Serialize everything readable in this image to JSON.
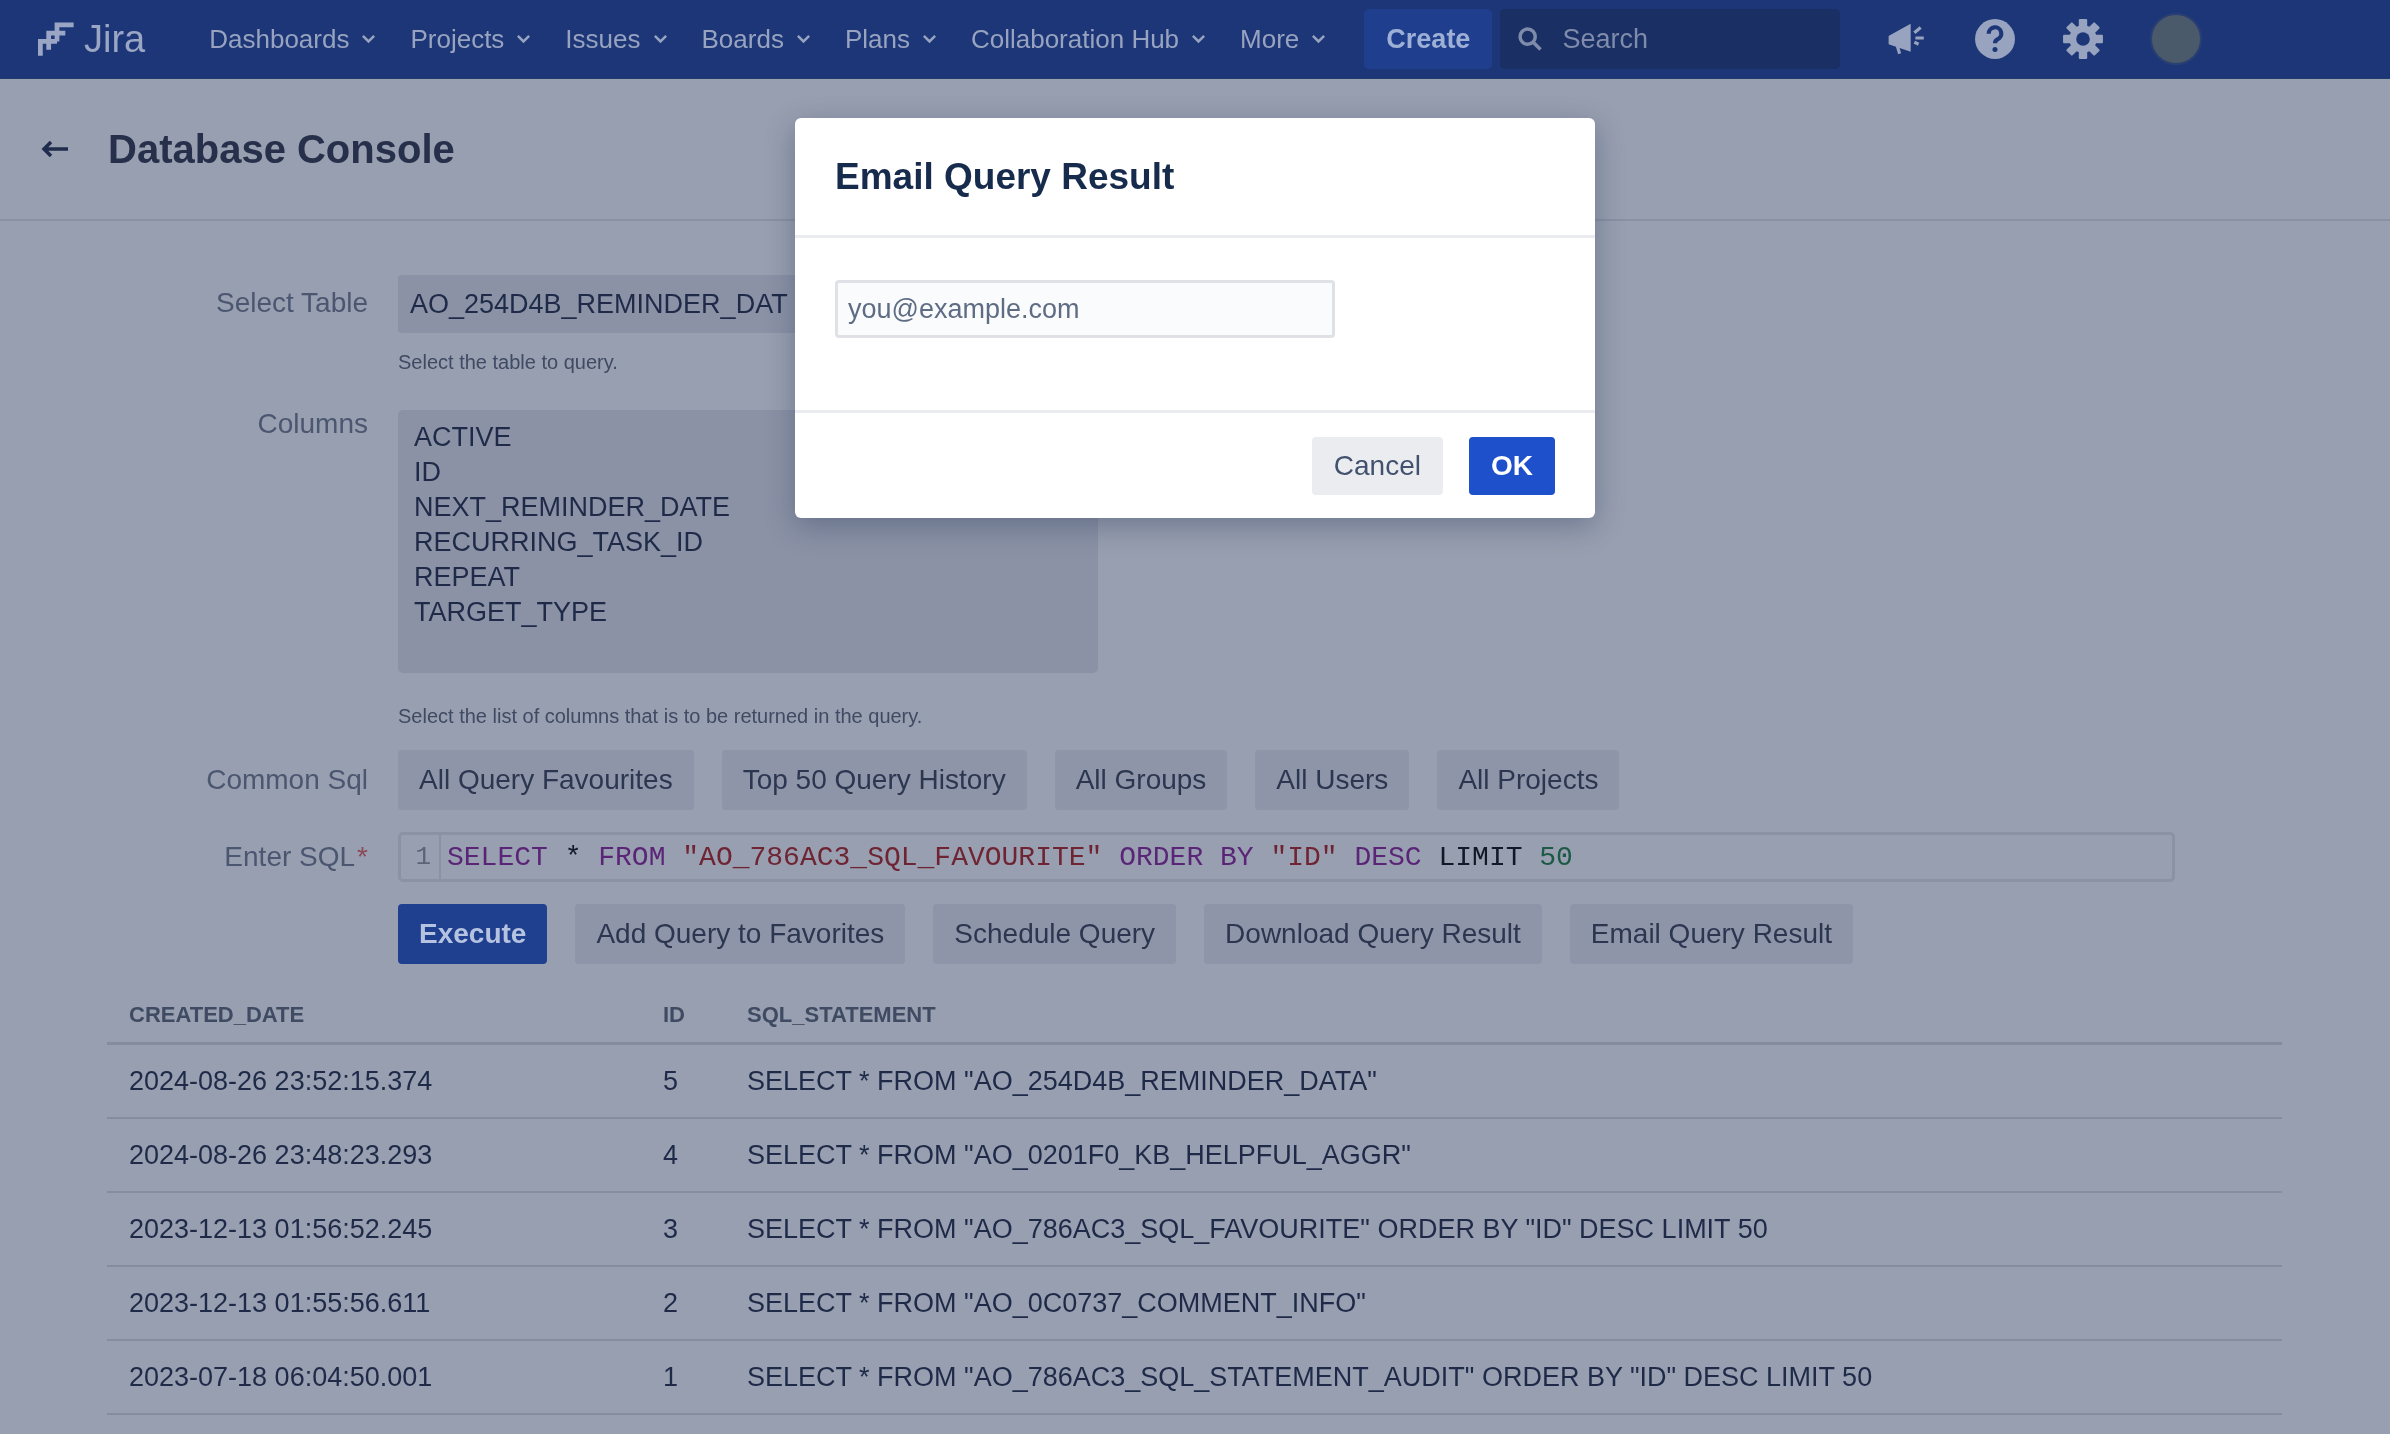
{
  "nav": {
    "logo": "Jira",
    "menus": [
      {
        "label": "Dashboards",
        "dropdown": true
      },
      {
        "label": "Projects",
        "dropdown": true
      },
      {
        "label": "Issues",
        "dropdown": true
      },
      {
        "label": "Boards",
        "dropdown": true
      },
      {
        "label": "Plans",
        "dropdown": true
      },
      {
        "label": "Collaboration Hub",
        "dropdown": true
      },
      {
        "label": "More",
        "dropdown": true
      }
    ],
    "create": "Create",
    "search": {
      "placeholder": "Search"
    }
  },
  "page": {
    "title": "Database Console"
  },
  "form": {
    "select_table": {
      "label": "Select Table",
      "value": "AO_254D4B_REMINDER_DAT",
      "help": "Select the table to query."
    },
    "columns": {
      "label": "Columns",
      "items": [
        "ACTIVE",
        "ID",
        "NEXT_REMINDER_DATE",
        "RECURRING_TASK_ID",
        "REPEAT",
        "TARGET_TYPE"
      ],
      "help": "Select the list of columns that is to be returned in the query."
    },
    "common_sql": {
      "label": "Common Sql",
      "buttons": [
        "All Query Favourites",
        "Top 50 Query History",
        "All Groups",
        "All Users",
        "All Projects"
      ]
    },
    "enter_sql": {
      "label": "Enter SQL",
      "required_mark": "*",
      "line_number": "1",
      "tokens": [
        {
          "kind": "keyword",
          "text": "SELECT"
        },
        {
          "kind": "operator",
          "text": "*"
        },
        {
          "kind": "keyword",
          "text": "FROM"
        },
        {
          "kind": "string",
          "text": "\"AO_786AC3_SQL_FAVOURITE\""
        },
        {
          "kind": "keyword",
          "text": "ORDER BY"
        },
        {
          "kind": "string",
          "text": "\"ID\""
        },
        {
          "kind": "keyword",
          "text": "DESC"
        },
        {
          "kind": "plain",
          "text": "LIMIT"
        },
        {
          "kind": "number",
          "text": "50"
        }
      ]
    },
    "actions": [
      {
        "label": "Execute",
        "primary": true
      },
      {
        "label": "Add Query to Favorites",
        "primary": false
      },
      {
        "label": "Schedule Query",
        "primary": false
      },
      {
        "label": "Download Query Result",
        "primary": false
      },
      {
        "label": "Email Query Result",
        "primary": false
      }
    ]
  },
  "table": {
    "columns": [
      "CREATED_DATE",
      "ID",
      "SQL_STATEMENT"
    ],
    "rows": [
      [
        "2024-08-26 23:52:15.374",
        "5",
        "SELECT * FROM \"AO_254D4B_REMINDER_DATA\""
      ],
      [
        "2024-08-26 23:48:23.293",
        "4",
        "SELECT * FROM \"AO_0201F0_KB_HELPFUL_AGGR\""
      ],
      [
        "2023-12-13 01:56:52.245",
        "3",
        "SELECT * FROM \"AO_786AC3_SQL_FAVOURITE\" ORDER BY \"ID\" DESC LIMIT 50"
      ],
      [
        "2023-12-13 01:55:56.611",
        "2",
        "SELECT * FROM \"AO_0C0737_COMMENT_INFO\""
      ],
      [
        "2023-07-18 06:04:50.001",
        "1",
        "SELECT * FROM \"AO_786AC3_SQL_STATEMENT_AUDIT\" ORDER BY \"ID\" DESC LIMIT 50"
      ]
    ]
  },
  "modal": {
    "title": "Email Query Result",
    "input": {
      "placeholder": "you@example.com"
    },
    "buttons": [
      {
        "label": "Cancel",
        "primary": false
      },
      {
        "label": "OK",
        "primary": true
      }
    ]
  }
}
